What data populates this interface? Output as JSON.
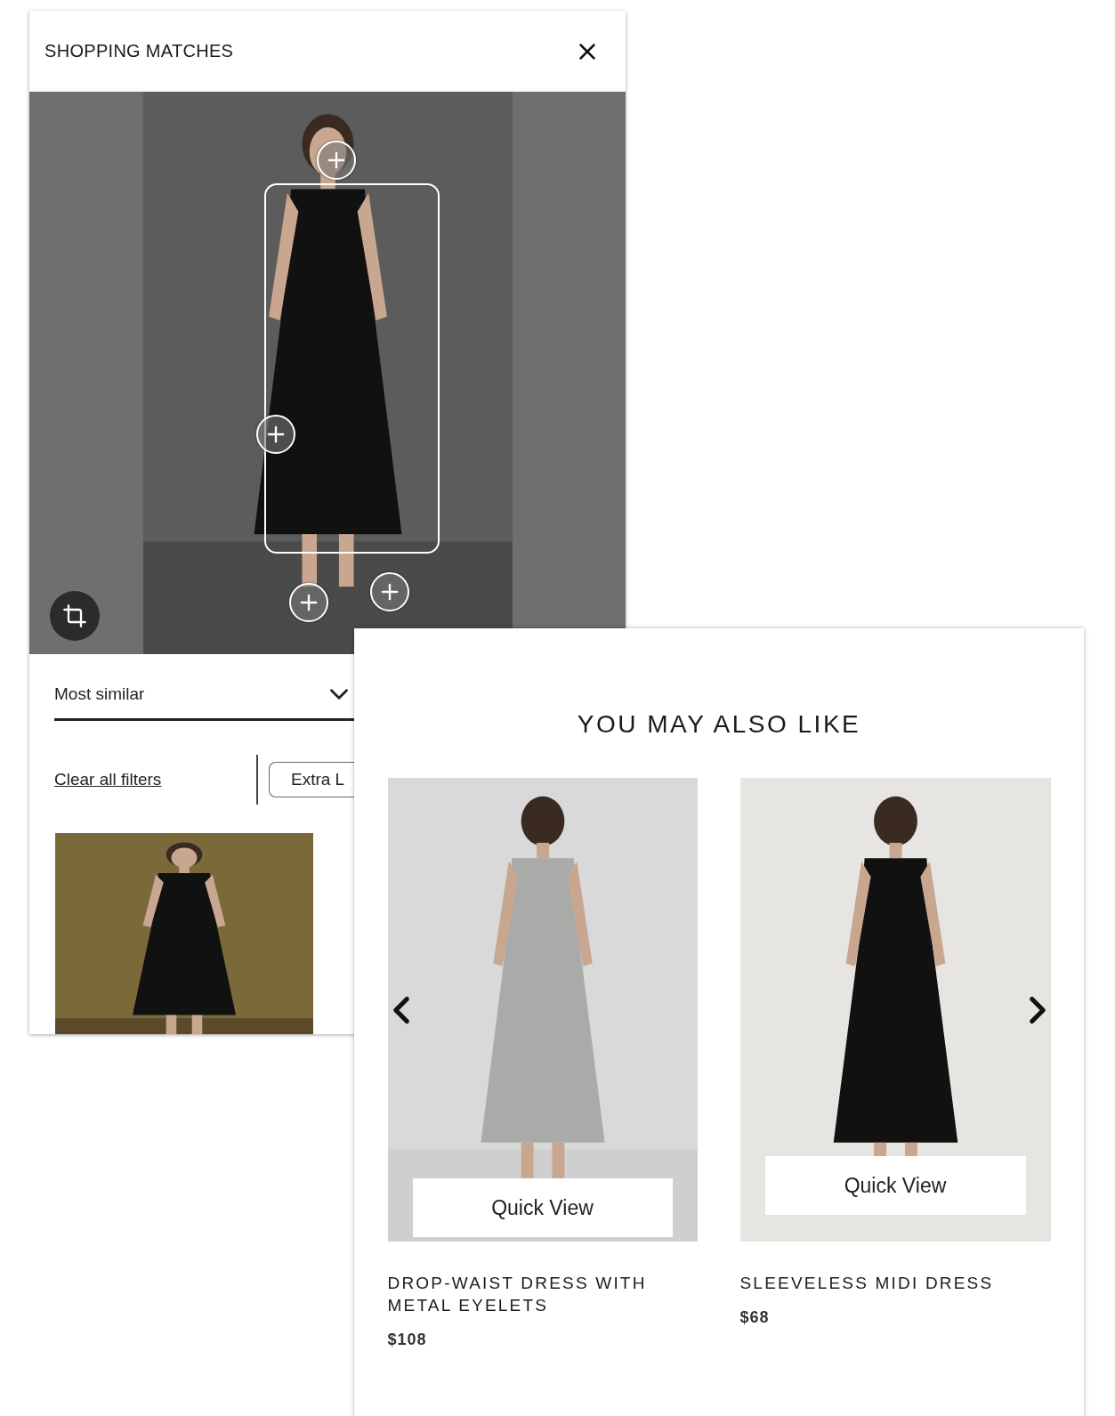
{
  "matches_panel": {
    "title": "SHOPPING MATCHES",
    "sort": {
      "value": "Most similar"
    },
    "clear_filters": "Clear all filters",
    "filters": [
      {
        "label": "Extra L"
      }
    ]
  },
  "recommendations": {
    "title": "YOU MAY ALSO LIKE",
    "products": [
      {
        "name": "DROP-WAIST DRESS WITH METAL EYELETS",
        "price": "$108",
        "quick_view": "Quick View"
      },
      {
        "name": "SLEEVELESS MIDI DRESS",
        "price": "$68",
        "quick_view": "Quick View"
      }
    ]
  }
}
